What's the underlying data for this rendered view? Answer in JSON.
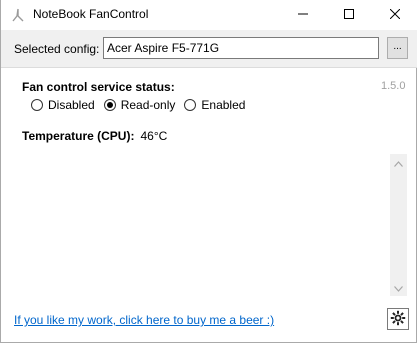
{
  "window": {
    "title": "NoteBook FanControl",
    "icons": {
      "app": "fan-app-icon",
      "minimize": "minimize-icon",
      "maximize": "maximize-icon",
      "close": "close-icon"
    }
  },
  "config": {
    "label": "Selected config:",
    "value": "Acer Aspire F5-771G",
    "browse_label": "..."
  },
  "version": "1.5.0",
  "service_status": {
    "title": "Fan control service status:",
    "options": [
      {
        "label": "Disabled",
        "checked": false
      },
      {
        "label": "Read-only",
        "checked": true
      },
      {
        "label": "Enabled",
        "checked": false
      }
    ]
  },
  "temperature": {
    "label": "Temperature (CPU):",
    "value": "46°C"
  },
  "footer": {
    "link_text": "If you like my work, click here to buy me a beer :)",
    "settings_icon": "gear-icon"
  },
  "colors": {
    "link": "#0066cc",
    "version_text": "#a0a0a0",
    "config_band": "#f0f0f0"
  }
}
